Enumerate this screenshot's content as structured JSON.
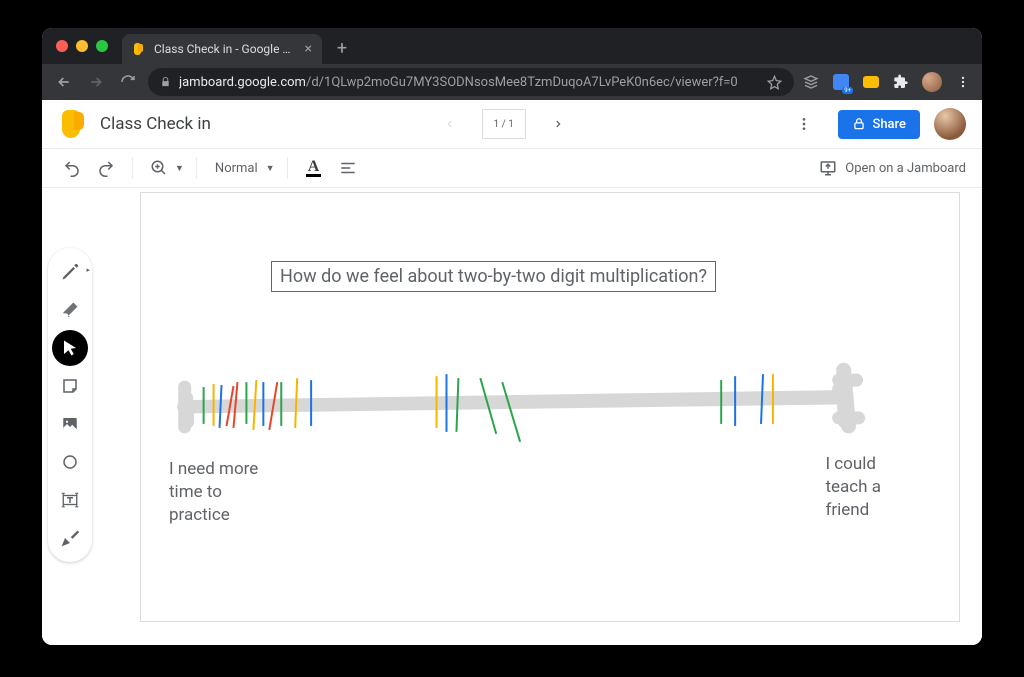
{
  "browser": {
    "tab_title": "Class Check in - Google Jambo",
    "url_domain": "jamboard.google.com",
    "url_path": "/d/1QLwp2moGu7MY3SODNsosMee8TzmDuqoA7LvPeK0n6ec/viewer?f=0"
  },
  "header": {
    "doc_title": "Class Check in",
    "frame_indicator": "1 / 1",
    "share_label": "Share"
  },
  "toolbar": {
    "zoom_label": "Normal",
    "open_jamboard_label": "Open on a Jamboard"
  },
  "canvas": {
    "question": "How do we feel about two-by-two digit multiplication?",
    "label_left_line1": "I need more",
    "label_left_line2": "time to",
    "label_left_line3": "practice",
    "label_right_line1": "I could",
    "label_right_line2": "teach a",
    "label_right_line3": "friend"
  },
  "tools": {
    "pen": "pen-icon",
    "eraser": "eraser-icon",
    "select": "cursor-icon",
    "note": "sticky-note-icon",
    "image": "image-icon",
    "shape": "circle-icon",
    "textbox": "text-box-icon",
    "laser": "laser-icon"
  }
}
